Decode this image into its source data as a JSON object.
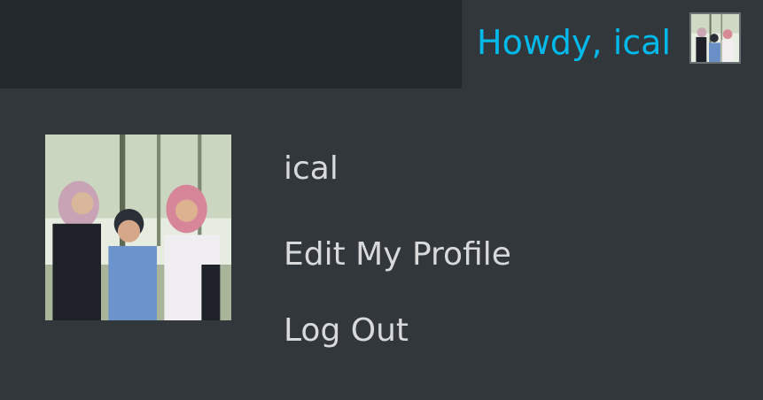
{
  "admin_bar": {
    "greeting": "Howdy, ical",
    "avatar_icon": "user-avatar-photo"
  },
  "account_menu": {
    "display_name": "ical",
    "edit_profile_label": "Edit My Profile",
    "logout_label": "Log Out",
    "avatar_icon": "user-avatar-photo"
  },
  "colors": {
    "bar_background": "#23282d",
    "menu_background": "#32373c",
    "greeting_accent": "#00b9eb",
    "menu_text": "#d7d9db"
  }
}
